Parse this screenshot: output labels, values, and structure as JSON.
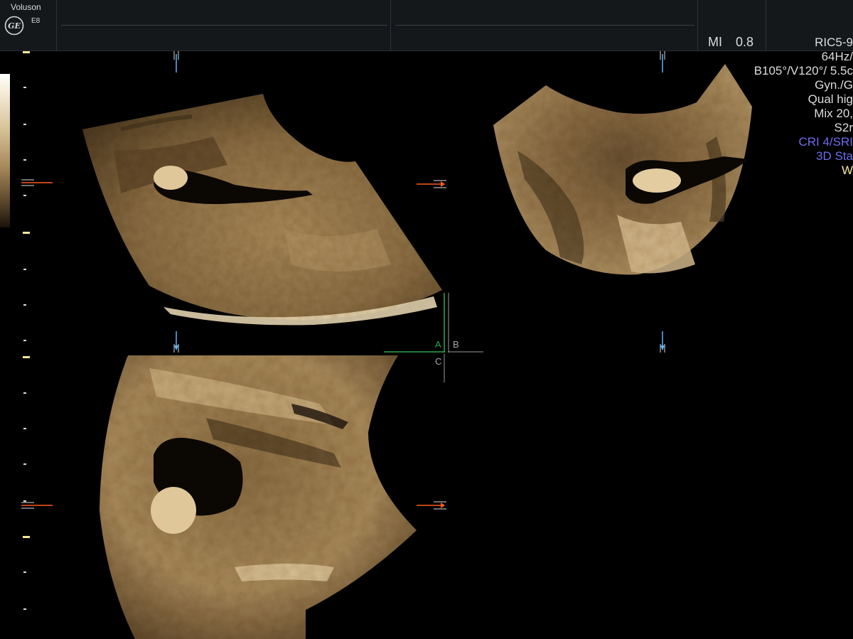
{
  "header": {
    "brand_name": "Voluson",
    "brand_model": "E8",
    "logo_text": "GE",
    "mi_label": "MI",
    "mi_value": "0.8"
  },
  "params": {
    "probe": "RIC5-9",
    "frame_rate": "64Hz/",
    "angle_volume": "B105°/V120°/ 5.5c",
    "preset": "Gyn./G",
    "quality": "Qual hig",
    "mix": "Mix 20,",
    "smoothing": "S2r",
    "cri_sri": "CRI 4/SRI",
    "mode_3d": "3D Sta",
    "w_flag": "W"
  },
  "quadrants": {
    "a_label": "A",
    "b_label": "B",
    "c_label": "C"
  },
  "colors": {
    "topbar_bg": "#15181b",
    "sepia_light": "#e9d5a6",
    "sepia_mid": "#9a7c4e",
    "sepia_dark": "#3a2a16",
    "marker_orange": "#ff5a1a",
    "marker_blue": "#5ab4ff",
    "plane_green": "#2ea84a",
    "text_blue": "#6e6cf0",
    "text_yellow": "#f3e79a"
  },
  "icons": {
    "logo": "ge-logo-icon",
    "depth_ticks": "depth-scale-icon",
    "orange_arrow": "orange-arrow-marker-icon",
    "blue_arrow": "blue-arrow-marker-icon"
  }
}
